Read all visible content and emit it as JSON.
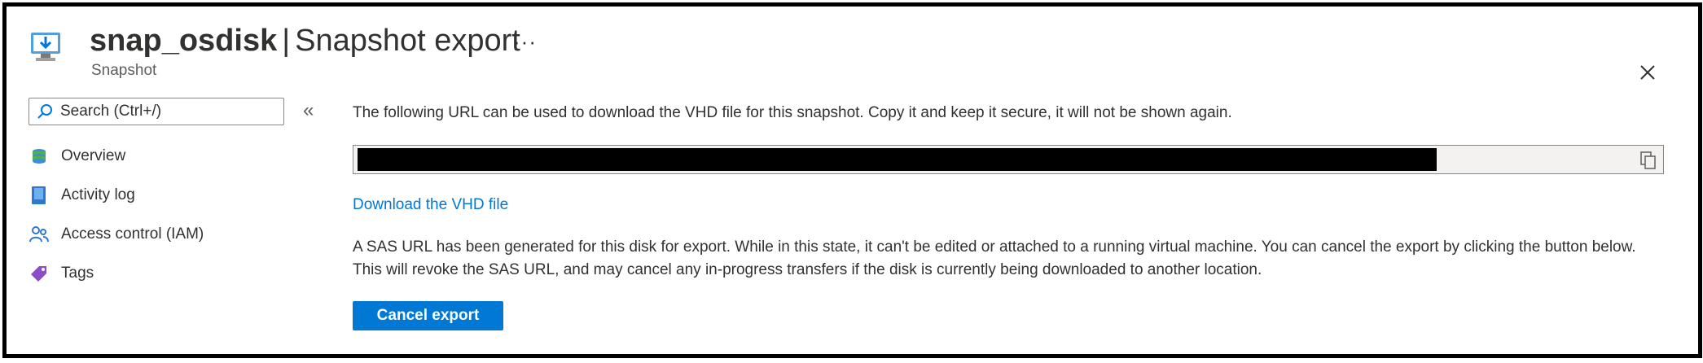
{
  "header": {
    "resource_name": "snap_osdisk",
    "separator": "|",
    "page_name": "Snapshot export",
    "subtitle": "Snapshot",
    "more_label": "···"
  },
  "sidebar": {
    "search_placeholder": "Search (Ctrl+/)",
    "collapse_label": "«",
    "items": [
      {
        "label": "Overview",
        "icon": "overview-icon"
      },
      {
        "label": "Activity log",
        "icon": "activity-log-icon"
      },
      {
        "label": "Access control (IAM)",
        "icon": "access-control-icon"
      },
      {
        "label": "Tags",
        "icon": "tag-icon"
      }
    ]
  },
  "main": {
    "intro_text": "The following URL can be used to download the VHD file for this snapshot. Copy it and keep it secure, it will not be shown again.",
    "download_link": "Download the VHD file",
    "notice_line1": "A SAS URL has been generated for this disk for export. While in this state, it can't be edited or attached to a running virtual machine. You can cancel the export by clicking the button below.",
    "notice_line2": "This will revoke the SAS URL, and may cancel any in-progress transfers if the disk is currently being downloaded to another location.",
    "cancel_button": "Cancel export"
  },
  "colors": {
    "accent": "#0078d4",
    "text": "#323130",
    "border": "#000000"
  }
}
